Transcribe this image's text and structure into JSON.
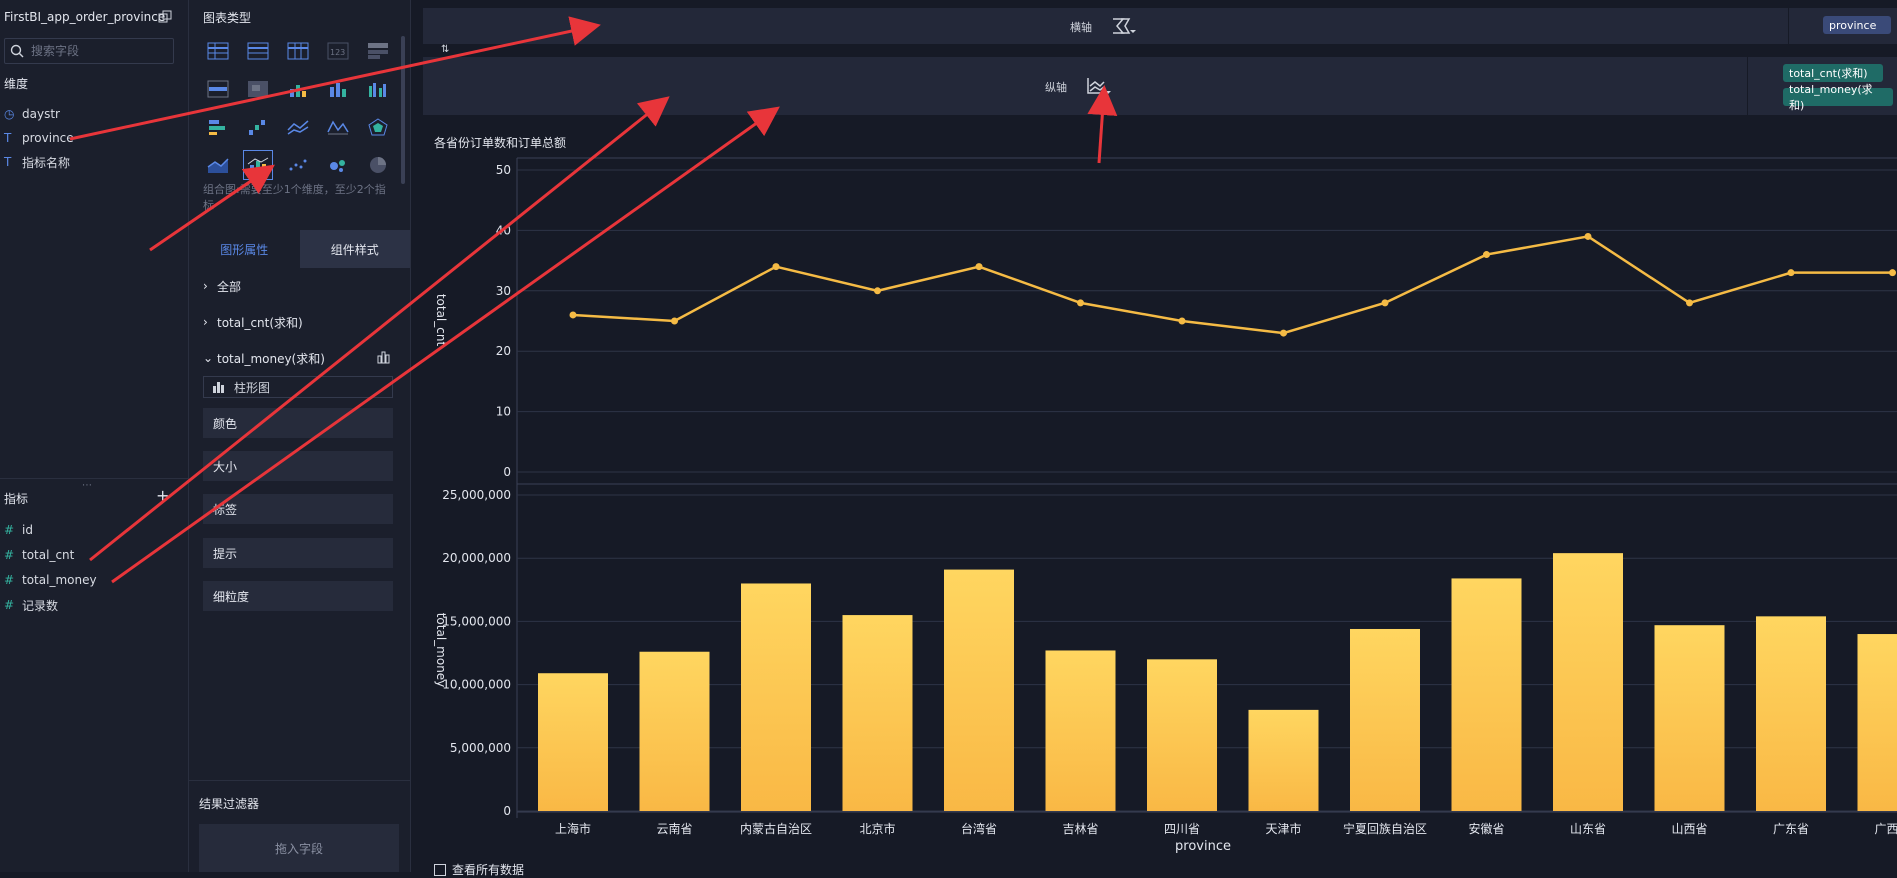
{
  "dataset": {
    "title": "FirstBI_app_order_province"
  },
  "search": {
    "placeholder": "搜索字段"
  },
  "dimensions": {
    "header": "维度",
    "items": [
      {
        "label": "daystr",
        "icon": "clock-icon"
      },
      {
        "label": "province",
        "icon": "text-type-icon"
      },
      {
        "label": "指标名称",
        "icon": "text-type-icon"
      }
    ]
  },
  "measures": {
    "header": "指标",
    "items": [
      {
        "label": "id"
      },
      {
        "label": "total_cnt"
      },
      {
        "label": "total_money"
      },
      {
        "label": "记录数"
      }
    ]
  },
  "chart_types": {
    "header": "图表类型",
    "hint": "组合图:需要至少1个维度，至少2个指标"
  },
  "tabs": {
    "graph_props": "图形属性",
    "component_style": "组件样式"
  },
  "properties": {
    "all": "全部",
    "total_cnt": "total_cnt(求和)",
    "total_money": "total_money(求和)",
    "chart_kind": "柱形图",
    "boxes": [
      "颜色",
      "大小",
      "标签",
      "提示",
      "细粒度"
    ]
  },
  "filter": {
    "header": "结果过滤器",
    "drop": "拖入字段"
  },
  "axes": {
    "x_label": "横轴",
    "y_label": "纵轴",
    "x_field": "province",
    "y_fields": [
      "total_cnt(求和)",
      "total_money(求和)"
    ]
  },
  "footer": {
    "checkbox": "查看所有数据"
  },
  "colors": {
    "line": "#f5bb45",
    "bar_top": "#ffd660",
    "bar_bottom": "#f9b845",
    "accent": "#5a88e6"
  },
  "chart_data": {
    "type": "combo",
    "title": "各省份订单数和订单总额",
    "xlabel": "province",
    "categories": [
      "上海市",
      "云南省",
      "内蒙古自治区",
      "北京市",
      "台湾省",
      "吉林省",
      "四川省",
      "天津市",
      "宁夏回族自治区",
      "安徽省",
      "山东省",
      "山西省",
      "广东省",
      "广西壮"
    ],
    "line": {
      "ylabel": "total_cnt",
      "ylim": [
        0,
        50
      ],
      "ticks": [
        "50",
        "40",
        "30",
        "20",
        "10",
        "0"
      ],
      "values": [
        26,
        25,
        34,
        30,
        34,
        28,
        25,
        23,
        28,
        36,
        39,
        28,
        33,
        33
      ]
    },
    "bar": {
      "ylabel": "total_money",
      "ylim": [
        0,
        25000000
      ],
      "ticks": [
        "25,000,000",
        "20,000,000",
        "15,000,000",
        "10,000,000",
        "5,000,000",
        "0"
      ],
      "values": [
        10900000,
        12600000,
        18000000,
        15500000,
        19100000,
        12700000,
        12000000,
        8000000,
        14400000,
        18400000,
        20400000,
        14700000,
        15400000,
        14000000
      ]
    },
    "grid": true
  }
}
